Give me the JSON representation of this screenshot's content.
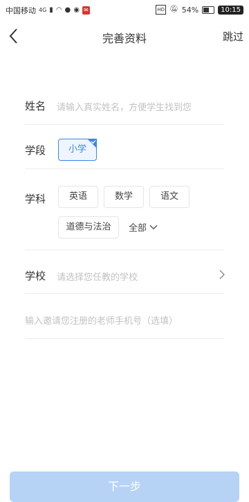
{
  "status_bar": {
    "carrier": "中国移动",
    "network": "4G",
    "battery": "54%",
    "time": "10:15",
    "icons": [
      "signal-icon",
      "wifi-icon",
      "chat-icon",
      "message-icon",
      "notification-icon",
      "hd-icon",
      "mute-icon",
      "battery-icon"
    ]
  },
  "nav": {
    "title": "完善资料",
    "skip_label": "跳过"
  },
  "form": {
    "name": {
      "label": "姓名",
      "placeholder": "请输入真实姓名，方便学生找到您"
    },
    "stage": {
      "label": "学段",
      "selected": "小学"
    },
    "subject": {
      "label": "学科",
      "options": [
        "英语",
        "数学",
        "语文",
        "道德与法治"
      ],
      "all_label": "全部"
    },
    "school": {
      "label": "学校",
      "placeholder": "请选择您任教的学校"
    },
    "invite": {
      "placeholder": "输入邀请您注册的老师手机号（选填）"
    }
  },
  "actions": {
    "next_label": "下一步"
  },
  "colors": {
    "accent": "#3b86ea",
    "button_disabled": "#b6d3f6",
    "placeholder": "#c2c2c2"
  }
}
